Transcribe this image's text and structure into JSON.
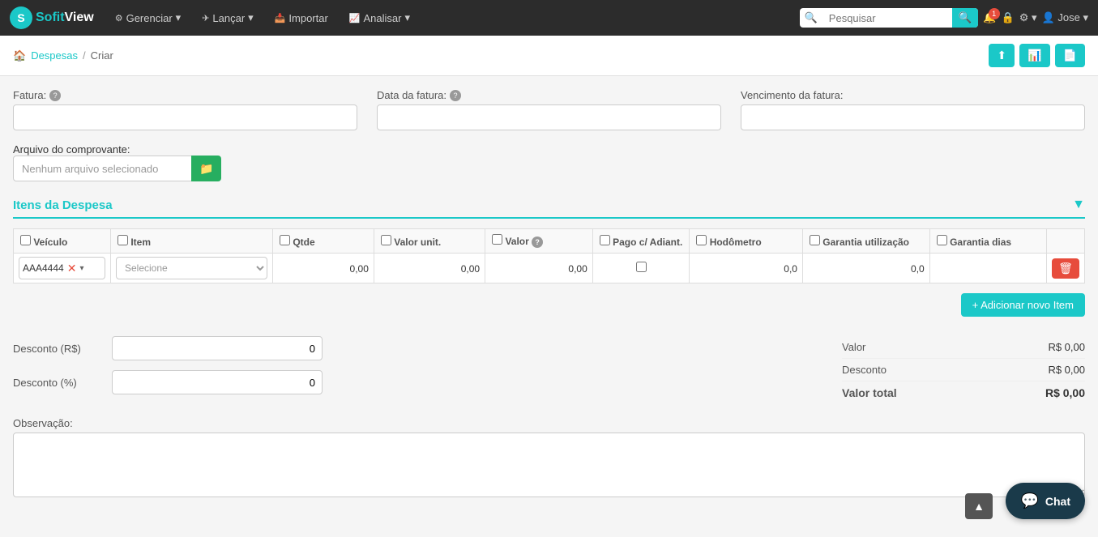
{
  "brand": {
    "logo_letter": "S",
    "sofit": "Sofit",
    "view": "View"
  },
  "navbar": {
    "items": [
      {
        "id": "gerenciar",
        "label": "Gerenciar",
        "icon": "⚙"
      },
      {
        "id": "lancar",
        "label": "Lançar",
        "icon": "✈"
      },
      {
        "id": "importar",
        "label": "Importar",
        "icon": "📥"
      },
      {
        "id": "analisar",
        "label": "Analisar",
        "icon": "📈"
      }
    ],
    "search_placeholder": "Pesquisar",
    "bell_badge": "1",
    "user": "Jose"
  },
  "breadcrumb": {
    "link_text": "Despesas",
    "separator": "/",
    "current": "Criar"
  },
  "form": {
    "fatura_label": "Fatura:",
    "data_fatura_label": "Data da fatura:",
    "vencimento_label": "Vencimento da fatura:",
    "arquivo_label": "Arquivo do comprovante:",
    "arquivo_placeholder": "Nenhum arquivo selecionado"
  },
  "items_section": {
    "title": "Itens da Despesa",
    "columns": {
      "veiculo": "Veículo",
      "item": "Item",
      "qtde": "Qtde",
      "valor_unit": "Valor unit.",
      "valor": "Valor",
      "pago": "Pago c/ Adiant.",
      "hodometro": "Hodômetro",
      "garantia_util": "Garantia utilização",
      "garantia_dias": "Garantia dias"
    },
    "row": {
      "vehicle_tag": "AAA4444",
      "item_placeholder": "Selecione",
      "qtde": "0,00",
      "valor_unit": "0,00",
      "valor": "0,00",
      "hodometro": "0,0",
      "garantia_util": "0,0",
      "garantia_dias": ""
    },
    "add_item_btn": "+ Adicionar novo Item"
  },
  "discounts": {
    "desconto_rs_label": "Desconto (R$)",
    "desconto_rs_value": "0",
    "desconto_pct_label": "Desconto (%)",
    "desconto_pct_value": "0"
  },
  "summary": {
    "valor_label": "Valor",
    "valor_value": "R$ 0,00",
    "desconto_label": "Desconto",
    "desconto_value": "R$ 0,00",
    "total_label": "Valor total",
    "total_value": "R$ 0,00"
  },
  "observacao": {
    "label": "Observação:",
    "placeholder": ""
  },
  "chat": {
    "label": "Chat"
  }
}
